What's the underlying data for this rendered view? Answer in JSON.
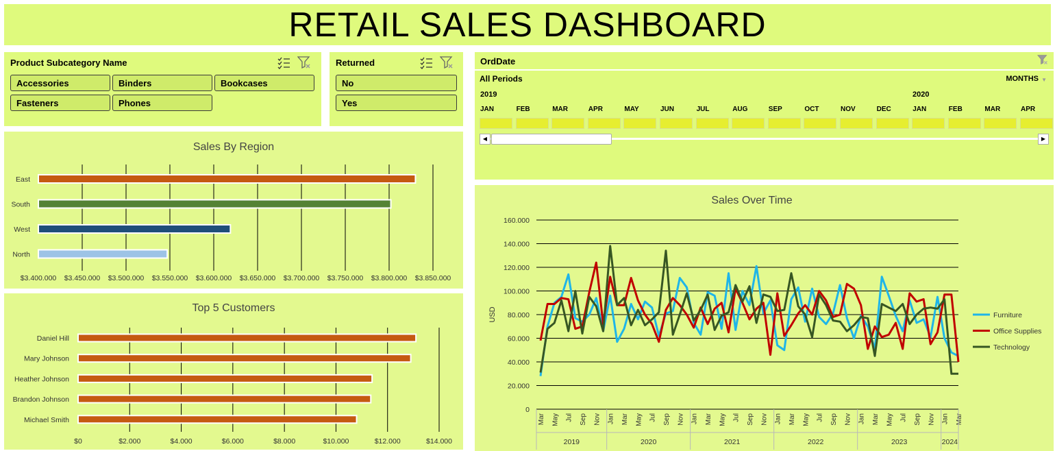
{
  "title": "RETAIL SALES DASHBOARD",
  "slicer_subcategory": {
    "header": "Product Subcategory Name",
    "items": [
      "Accessories",
      "Binders",
      "Bookcases",
      "Fasteners",
      "Phones"
    ],
    "multi_select_icon": "multi-select-icon",
    "clear_filter_icon": "clear-filter-icon"
  },
  "slicer_returned": {
    "header": "Returned",
    "items": [
      "No",
      "Yes"
    ]
  },
  "timeline": {
    "header": "OrdDate",
    "period_label": "All Periods",
    "level": "MONTHS",
    "years": [
      "2019",
      "2020"
    ],
    "months": [
      "JAN",
      "FEB",
      "MAR",
      "APR",
      "MAY",
      "JUN",
      "JUL",
      "AUG",
      "SEP",
      "OCT",
      "NOV",
      "DEC",
      "JAN",
      "FEB",
      "MAR",
      "APR"
    ],
    "scroll_left_icon": "scroll-left-icon",
    "scroll_right_icon": "scroll-right-icon"
  },
  "colors": {
    "panel": "#dffa7d",
    "east": "#c55a11",
    "south": "#548235",
    "west": "#1f4e79",
    "north": "#9dc3e6",
    "customer": "#c55a11",
    "furniture": "#1fb5e8",
    "office": "#c00000",
    "technology": "#375623",
    "timeline_cell": "#e6ee30"
  },
  "chart_data": [
    {
      "type": "bar",
      "orientation": "horizontal",
      "title": "Sales By Region",
      "categories": [
        "East",
        "South",
        "West",
        "North"
      ],
      "values": [
        3830000,
        3802000,
        3619000,
        3547000
      ],
      "xlim": [
        3400000,
        3850000
      ],
      "ticks": [
        "$3.400.000",
        "$3.450.000",
        "$3.500.000",
        "$3.550.000",
        "$3.600.000",
        "$3.650.000",
        "$3.700.000",
        "$3.750.000",
        "$3.800.000",
        "$3.850.000"
      ],
      "grid": true
    },
    {
      "type": "bar",
      "orientation": "horizontal",
      "title": "Top 5 Customers",
      "categories": [
        "Daniel Hill",
        "Mary Johnson",
        "Heather Johnson",
        "Brandon Johnson",
        "Michael Smith"
      ],
      "values": [
        13100,
        12900,
        11400,
        11350,
        10800
      ],
      "xlim": [
        0,
        14000
      ],
      "ticks": [
        "$0",
        "$2.000",
        "$4.000",
        "$6.000",
        "$8.000",
        "$10.000",
        "$12.000",
        "$14.000"
      ],
      "grid": true
    },
    {
      "type": "line",
      "title": "Sales Over Time",
      "ylabel": "USD",
      "ylim": [
        0,
        160000
      ],
      "yticks": [
        "0",
        "20.000",
        "40.000",
        "60.000",
        "80.000",
        "100.000",
        "120.000",
        "140.000",
        "160.000"
      ],
      "x_month_labels": [
        "Mar",
        "May",
        "Jul",
        "Sep",
        "Nov",
        "Jan",
        "Mar",
        "May",
        "Jul",
        "Sep",
        "Nov",
        "Jan",
        "Mar",
        "May",
        "Jul",
        "Sep",
        "Nov",
        "Jan",
        "Mar",
        "May",
        "Jul",
        "Sep",
        "Nov",
        "Jan",
        "Mar",
        "May",
        "Jul",
        "Sep",
        "Nov",
        "Jan",
        "Mar"
      ],
      "x_years": [
        "2019",
        "2020",
        "2021",
        "2022",
        "2023",
        "2024"
      ],
      "legend_position": "right",
      "series": [
        {
          "name": "Furniture",
          "values": [
            28000,
            70000,
            90000,
            95000,
            114000,
            77000,
            74000,
            80000,
            94000,
            66000,
            96000,
            57000,
            68000,
            89000,
            76000,
            91000,
            86000,
            62000,
            81000,
            83000,
            111000,
            103000,
            73000,
            63000,
            99000,
            96000,
            68000,
            115000,
            67000,
            100000,
            88000,
            121000,
            81000,
            92000,
            54000,
            50000,
            93000,
            103000,
            74000,
            102000,
            78000,
            72000,
            81000,
            105000,
            77000,
            60000,
            79000,
            70000,
            51000,
            112000,
            96000,
            79000,
            66000,
            92000,
            73000,
            76000,
            61000,
            95000,
            60000,
            48000,
            45000
          ]
        },
        {
          "name": "Office Supplies",
          "values": [
            58000,
            89000,
            89000,
            94000,
            93000,
            68000,
            70000,
            99000,
            124000,
            72000,
            112000,
            88000,
            88000,
            111000,
            92000,
            80000,
            72000,
            57000,
            84000,
            94000,
            88000,
            80000,
            69000,
            86000,
            72000,
            85000,
            90000,
            65000,
            102000,
            90000,
            76000,
            85000,
            90000,
            46000,
            98000,
            62000,
            71000,
            81000,
            88000,
            80000,
            100000,
            92000,
            78000,
            80000,
            106000,
            102000,
            88000,
            51000,
            70000,
            61000,
            63000,
            73000,
            51000,
            98000,
            91000,
            93000,
            55000,
            65000,
            97000,
            97000,
            40000
          ]
        },
        {
          "name": "Technology",
          "values": [
            31000,
            68000,
            73000,
            92000,
            66000,
            100000,
            64000,
            95000,
            87000,
            66000,
            138000,
            88000,
            94000,
            71000,
            84000,
            71000,
            76000,
            82000,
            134000,
            63000,
            80000,
            98000,
            75000,
            84000,
            97000,
            67000,
            79000,
            82000,
            105000,
            91000,
            104000,
            73000,
            97000,
            95000,
            83000,
            84000,
            115000,
            87000,
            80000,
            61000,
            97000,
            88000,
            75000,
            74000,
            66000,
            71000,
            78000,
            77000,
            45000,
            89000,
            86000,
            83000,
            89000,
            72000,
            80000,
            85000,
            86000,
            85000,
            93000,
            30000,
            30000
          ]
        }
      ]
    }
  ]
}
